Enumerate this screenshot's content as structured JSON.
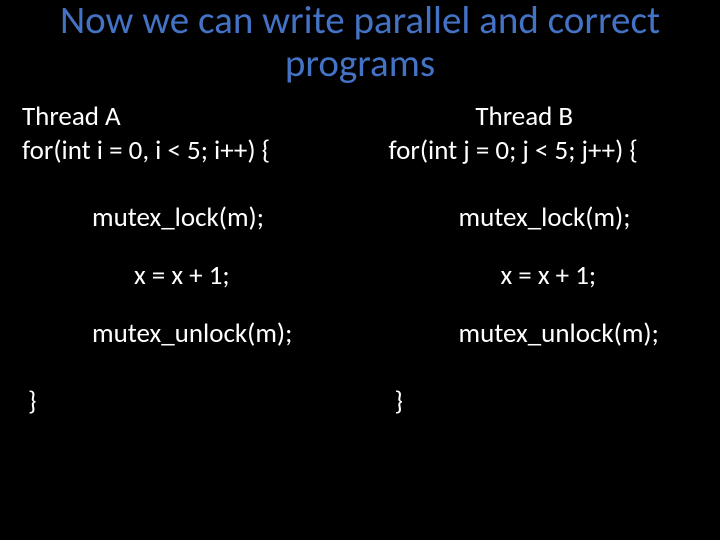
{
  "title": "Now we can write parallel and correct programs",
  "threadA": {
    "heading": "Thread A",
    "for": "for(int i = 0, i < 5; i++) {",
    "lock": "mutex_lock(m);",
    "incr": "x = x + 1;",
    "unlock": "mutex_unlock(m);",
    "close": "}"
  },
  "threadB": {
    "heading": "Thread B",
    "for": "for(int j = 0; j < 5; j++) {",
    "lock": "mutex_lock(m);",
    "incr": "x = x + 1;",
    "unlock": "mutex_unlock(m);",
    "close": "}"
  }
}
